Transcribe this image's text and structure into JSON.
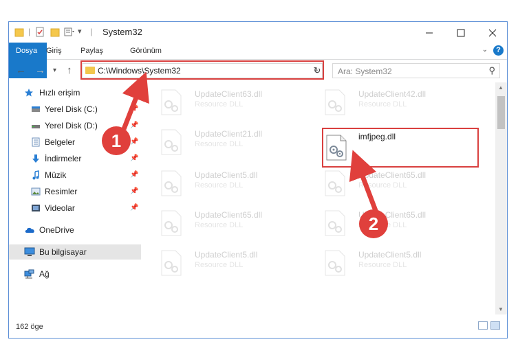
{
  "window": {
    "title": "System32",
    "minimize_icon": "minimize-icon",
    "maximize_icon": "maximize-icon",
    "close_icon": "close-icon"
  },
  "ribbon": {
    "tabs": [
      "Dosya",
      "Giriş",
      "Paylaş",
      "Görünüm"
    ],
    "help_label": "?"
  },
  "nav": {
    "address": "C:\\Windows\\System32",
    "search_placeholder": "Ara: System32"
  },
  "sidebar": {
    "items": [
      {
        "label": "Hızlı erişim",
        "icon": "star-icon",
        "pinned": false
      },
      {
        "label": "Yerel Disk (C:)",
        "icon": "drive-icon",
        "pinned": true
      },
      {
        "label": "Yerel Disk (D:)",
        "icon": "drive-icon",
        "pinned": true
      },
      {
        "label": "Belgeler",
        "icon": "documents-icon",
        "pinned": true
      },
      {
        "label": "İndirmeler",
        "icon": "download-icon",
        "pinned": true
      },
      {
        "label": "Müzik",
        "icon": "music-icon",
        "pinned": true
      },
      {
        "label": "Resimler",
        "icon": "pictures-icon",
        "pinned": true
      },
      {
        "label": "Videolar",
        "icon": "videos-icon",
        "pinned": true
      },
      {
        "label": "OneDrive",
        "icon": "cloud-icon",
        "pinned": false
      },
      {
        "label": "Bu bilgisayar",
        "icon": "computer-icon",
        "pinned": false,
        "selected": true
      },
      {
        "label": "Ağ",
        "icon": "network-icon",
        "pinned": false
      }
    ]
  },
  "files": [
    {
      "name": "UpdateClient63.dll",
      "type": "Resource DLL",
      "faded": true
    },
    {
      "name": "UpdateClient42.dll",
      "type": "Resource DLL",
      "faded": true
    },
    {
      "name": "UpdateClient21.dll",
      "type": "Resource DLL",
      "faded": true
    },
    {
      "name": "imfjpeg.dll",
      "type": "",
      "faded": false,
      "highlighted": true
    },
    {
      "name": "UpdateClient5.dll",
      "type": "Resource DLL",
      "faded": true
    },
    {
      "name": "UpdateClient65.dll",
      "type": "Resource DLL",
      "faded": true
    },
    {
      "name": "UpdateClient65.dll",
      "type": "Resource DLL",
      "faded": true
    },
    {
      "name": "UpdateClient65.dll",
      "type": "Resource DLL",
      "faded": true
    },
    {
      "name": "UpdateClient5.dll",
      "type": "Resource DLL",
      "faded": true
    },
    {
      "name": "UpdateClient5.dll",
      "type": "Resource DLL",
      "faded": true
    }
  ],
  "status": {
    "item_count": "162 öge"
  },
  "annotations": {
    "step1": "1",
    "step2": "2",
    "accent": "#e0403c"
  }
}
